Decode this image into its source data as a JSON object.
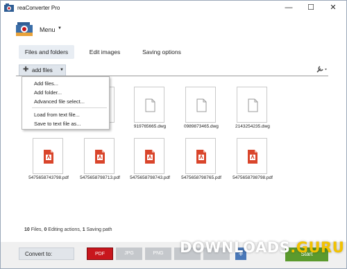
{
  "window": {
    "title": "reaConverter Pro",
    "controls": [
      "—",
      "☐",
      "✕"
    ]
  },
  "menu": {
    "label": "Menu"
  },
  "tabs": [
    {
      "label": "Files and folders",
      "active": true
    },
    {
      "label": "Edit images",
      "active": false
    },
    {
      "label": "Saving options",
      "active": false
    }
  ],
  "toolbar": {
    "add_files_label": "add files"
  },
  "dropdown": {
    "items": [
      "Add files...",
      "Add folder...",
      "Advanced file select...",
      "Load from text file...",
      "Save to text file as..."
    ]
  },
  "files": [
    {
      "name": "",
      "kind": "dwg"
    },
    {
      "name": "",
      "kind": "dwg"
    },
    {
      "name": "919765665.dwg",
      "kind": "dwg"
    },
    {
      "name": "0989873465.dwg",
      "kind": "dwg"
    },
    {
      "name": "2143254235.dwg",
      "kind": "dwg"
    },
    {
      "name": "5475658743798.pdf",
      "kind": "pdf"
    },
    {
      "name": "5475658798713.pdf",
      "kind": "pdf"
    },
    {
      "name": "5475658798743.pdf",
      "kind": "pdf"
    },
    {
      "name": "5475658798765.pdf",
      "kind": "pdf"
    },
    {
      "name": "5475658798798.pdf",
      "kind": "pdf"
    }
  ],
  "status": {
    "files_count": "10",
    "files_label": "Files,",
    "edits_count": "0",
    "edits_label": "Editing actions,",
    "paths_count": "1",
    "paths_label": "Saving path"
  },
  "convert": {
    "label": "Convert to:",
    "formats": [
      {
        "label": "PDF",
        "selected": true
      },
      {
        "label": "JPG",
        "selected": false
      },
      {
        "label": "PNG",
        "selected": false
      }
    ],
    "add_symbol": "+",
    "start_label": "Start"
  },
  "watermark": {
    "text_a": "DOWNLOADS",
    "text_b": ".GURU"
  },
  "colors": {
    "accent_red": "#c8161d",
    "pdf_icon": "#d9452b",
    "start_green": "#5b9a2d",
    "tab_active": "#e8edf3"
  }
}
